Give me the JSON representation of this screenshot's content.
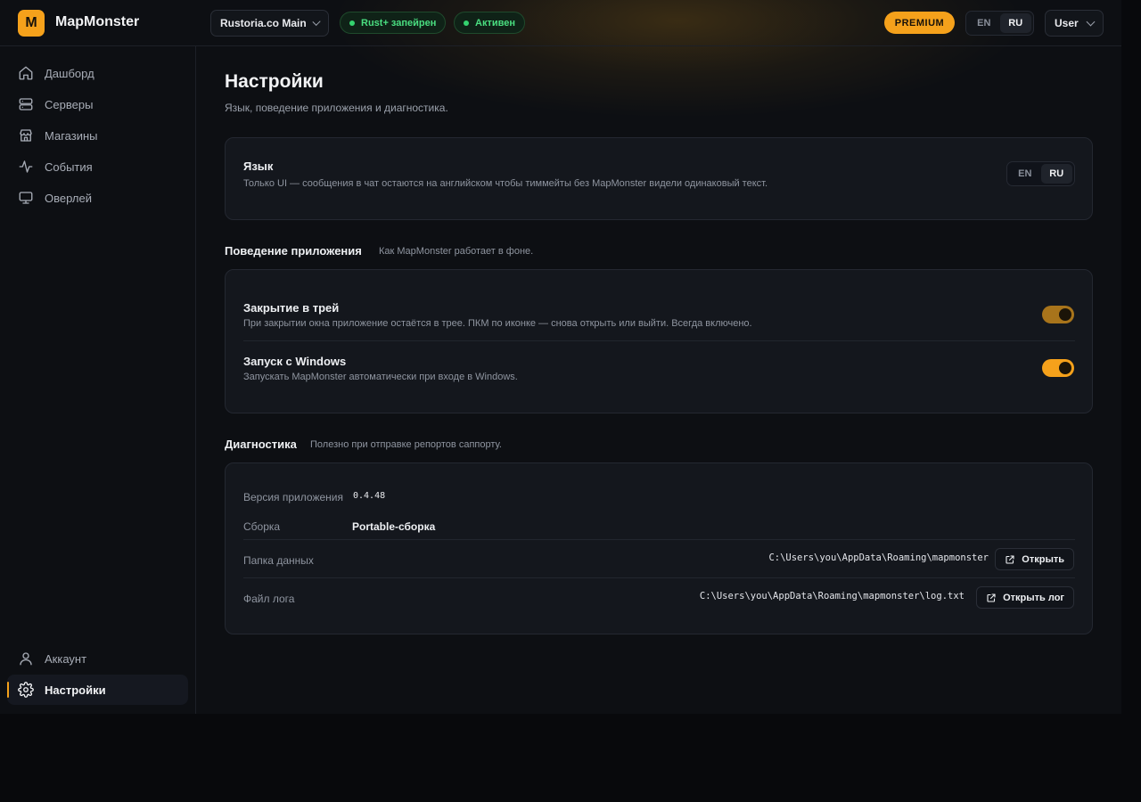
{
  "header": {
    "logo_letter": "M",
    "brand": "MapMonster",
    "server_select": "Rustoria.co Main",
    "badge_paired": "Rust+ запейрен",
    "badge_active": "Активен",
    "premium": "PREMIUM",
    "lang": {
      "en": "EN",
      "ru": "RU",
      "selected": "RU"
    },
    "user": "User"
  },
  "sidebar": {
    "items": [
      {
        "label": "Дашборд",
        "icon": "home-icon"
      },
      {
        "label": "Серверы",
        "icon": "server-icon"
      },
      {
        "label": "Магазины",
        "icon": "store-icon"
      },
      {
        "label": "События",
        "icon": "activity-icon"
      },
      {
        "label": "Оверлей",
        "icon": "monitor-icon"
      }
    ],
    "bottom": [
      {
        "label": "Аккаунт",
        "icon": "user-icon"
      },
      {
        "label": "Настройки",
        "icon": "gear-icon",
        "active": true
      }
    ]
  },
  "page": {
    "title": "Настройки",
    "subtitle": "Язык, поведение приложения и диагностика."
  },
  "language_card": {
    "title": "Язык",
    "desc": "Только UI — сообщения в чат остаются на английском чтобы тиммейты без MapMonster видели одинаковый текст.",
    "en": "EN",
    "ru": "RU",
    "selected": "RU"
  },
  "behavior": {
    "heading": "Поведение приложения",
    "sub": "Как MapMonster работает в фоне.",
    "tray": {
      "title": "Закрытие в трей",
      "desc": "При закрытии окна приложение остаётся в трее. ПКМ по иконке — снова открыть или выйти. Всегда включено.",
      "enabled": true
    },
    "autostart": {
      "title": "Запуск с Windows",
      "desc": "Запускать MapMonster автоматически при входе в Windows.",
      "enabled": true
    }
  },
  "diagnostics": {
    "heading": "Диагностика",
    "sub": "Полезно при отправке репортов саппорту.",
    "version_label": "Версия приложения",
    "version": "0.4.48",
    "build_label": "Сборка",
    "build": "Portable-сборка",
    "data_folder_label": "Папка данных",
    "data_folder": "C:\\Users\\you\\AppData\\Roaming\\mapmonster",
    "open_label": "Открыть",
    "log_label": "Файл лога",
    "log_file": "C:\\Users\\you\\AppData\\Roaming\\mapmonster\\log.txt",
    "open_log_label": "Открыть лог"
  },
  "colors": {
    "accent": "#f5a11b",
    "success": "#34d36f",
    "background": "#0d0f13",
    "card": "#14171d"
  }
}
